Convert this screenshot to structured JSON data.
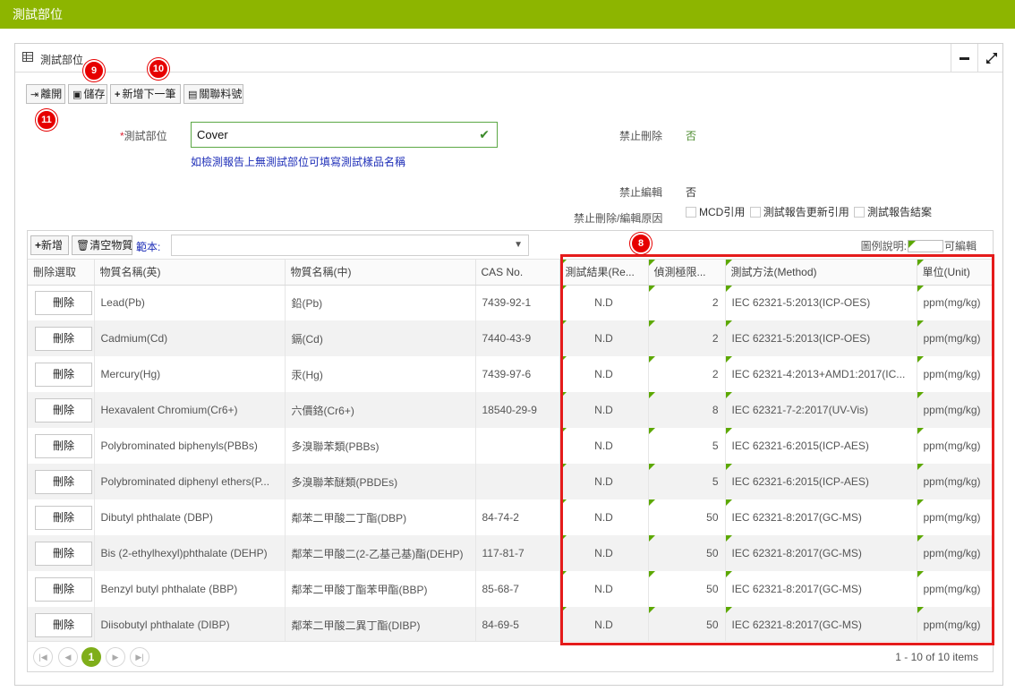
{
  "window": {
    "title": "測試部位"
  },
  "panel": {
    "title": "測試部位"
  },
  "toolbar": {
    "leave_label": "離開",
    "save_label": "儲存",
    "add_next_label": "新增下一筆",
    "link_label": "關聯料號"
  },
  "badges": {
    "b8": "8",
    "b9": "9",
    "b10": "10",
    "b11": "11"
  },
  "form": {
    "test_part_label": "測試部位",
    "test_part_value": "Cover",
    "test_part_hint": "如檢測報告上無測試部位可填寫測試樣品名稱",
    "no_delete_label": "禁止刪除",
    "no_delete_value": "否",
    "no_edit_label": "禁止編輯",
    "no_edit_value": "否",
    "reason_label": "禁止刪除/編輯原因",
    "reasons": [
      "MCD引用",
      "測試報告更新引用",
      "測試報告結案"
    ]
  },
  "grid": {
    "add_label": "新增",
    "clear_label": "清空物質",
    "template_label": "範本:",
    "template_value": "",
    "legend_label": "圖例說明:",
    "legend_editable": "可編輯",
    "columns": [
      "刪除選取",
      "物質名稱(英)",
      "物質名稱(中)",
      "CAS No.",
      "測試結果(Re...",
      "偵測極限...",
      "測試方法(Method)",
      "單位(Unit)"
    ],
    "delete_label": "刪除",
    "rows": [
      {
        "en": "Lead(Pb)",
        "zh": "鉛(Pb)",
        "cas": "7439-92-1",
        "result": "N.D",
        "limit": "2",
        "method": "IEC 62321-5:2013(ICP-OES)",
        "unit": "ppm(mg/kg)"
      },
      {
        "en": "Cadmium(Cd)",
        "zh": "鎘(Cd)",
        "cas": "7440-43-9",
        "result": "N.D",
        "limit": "2",
        "method": "IEC 62321-5:2013(ICP-OES)",
        "unit": "ppm(mg/kg)"
      },
      {
        "en": "Mercury(Hg)",
        "zh": "汞(Hg)",
        "cas": "7439-97-6",
        "result": "N.D",
        "limit": "2",
        "method": "IEC 62321-4:2013+AMD1:2017(IC...",
        "unit": "ppm(mg/kg)"
      },
      {
        "en": "Hexavalent Chromium(Cr6+)",
        "zh": "六價鉻(Cr6+)",
        "cas": "18540-29-9",
        "result": "N.D",
        "limit": "8",
        "method": "IEC 62321-7-2:2017(UV-Vis)",
        "unit": "ppm(mg/kg)"
      },
      {
        "en": "Polybrominated biphenyls(PBBs)",
        "zh": "多溴聯苯類(PBBs)",
        "cas": "",
        "result": "N.D",
        "limit": "5",
        "method": "IEC 62321-6:2015(ICP-AES)",
        "unit": "ppm(mg/kg)"
      },
      {
        "en": "Polybrominated diphenyl ethers(P...",
        "zh": "多溴聯苯醚類(PBDEs)",
        "cas": "",
        "result": "N.D",
        "limit": "5",
        "method": "IEC 62321-6:2015(ICP-AES)",
        "unit": "ppm(mg/kg)"
      },
      {
        "en": "Dibutyl phthalate (DBP)",
        "zh": "鄰苯二甲酸二丁酯(DBP)",
        "cas": "84-74-2",
        "result": "N.D",
        "limit": "50",
        "method": "IEC 62321-8:2017(GC-MS)",
        "unit": "ppm(mg/kg)"
      },
      {
        "en": "Bis (2-ethylhexyl)phthalate (DEHP)",
        "zh": "鄰苯二甲酸二(2-乙基己基)酯(DEHP)",
        "cas": "117-81-7",
        "result": "N.D",
        "limit": "50",
        "method": "IEC 62321-8:2017(GC-MS)",
        "unit": "ppm(mg/kg)"
      },
      {
        "en": "Benzyl butyl phthalate (BBP)",
        "zh": "鄰苯二甲酸丁酯苯甲酯(BBP)",
        "cas": "85-68-7",
        "result": "N.D",
        "limit": "50",
        "method": "IEC 62321-8:2017(GC-MS)",
        "unit": "ppm(mg/kg)"
      },
      {
        "en": "Diisobutyl phthalate (DIBP)",
        "zh": "鄰苯二甲酸二異丁酯(DIBP)",
        "cas": "84-69-5",
        "result": "N.D",
        "limit": "50",
        "method": "IEC 62321-8:2017(GC-MS)",
        "unit": "ppm(mg/kg)"
      }
    ]
  },
  "pager": {
    "current_page": "1",
    "info": "1 - 10 of 10 items"
  },
  "colors": {
    "brand": "#8db500",
    "editable_marker": "#5ca800",
    "highlight": "#e51b1b",
    "link_blue": "#1f2fb8"
  }
}
